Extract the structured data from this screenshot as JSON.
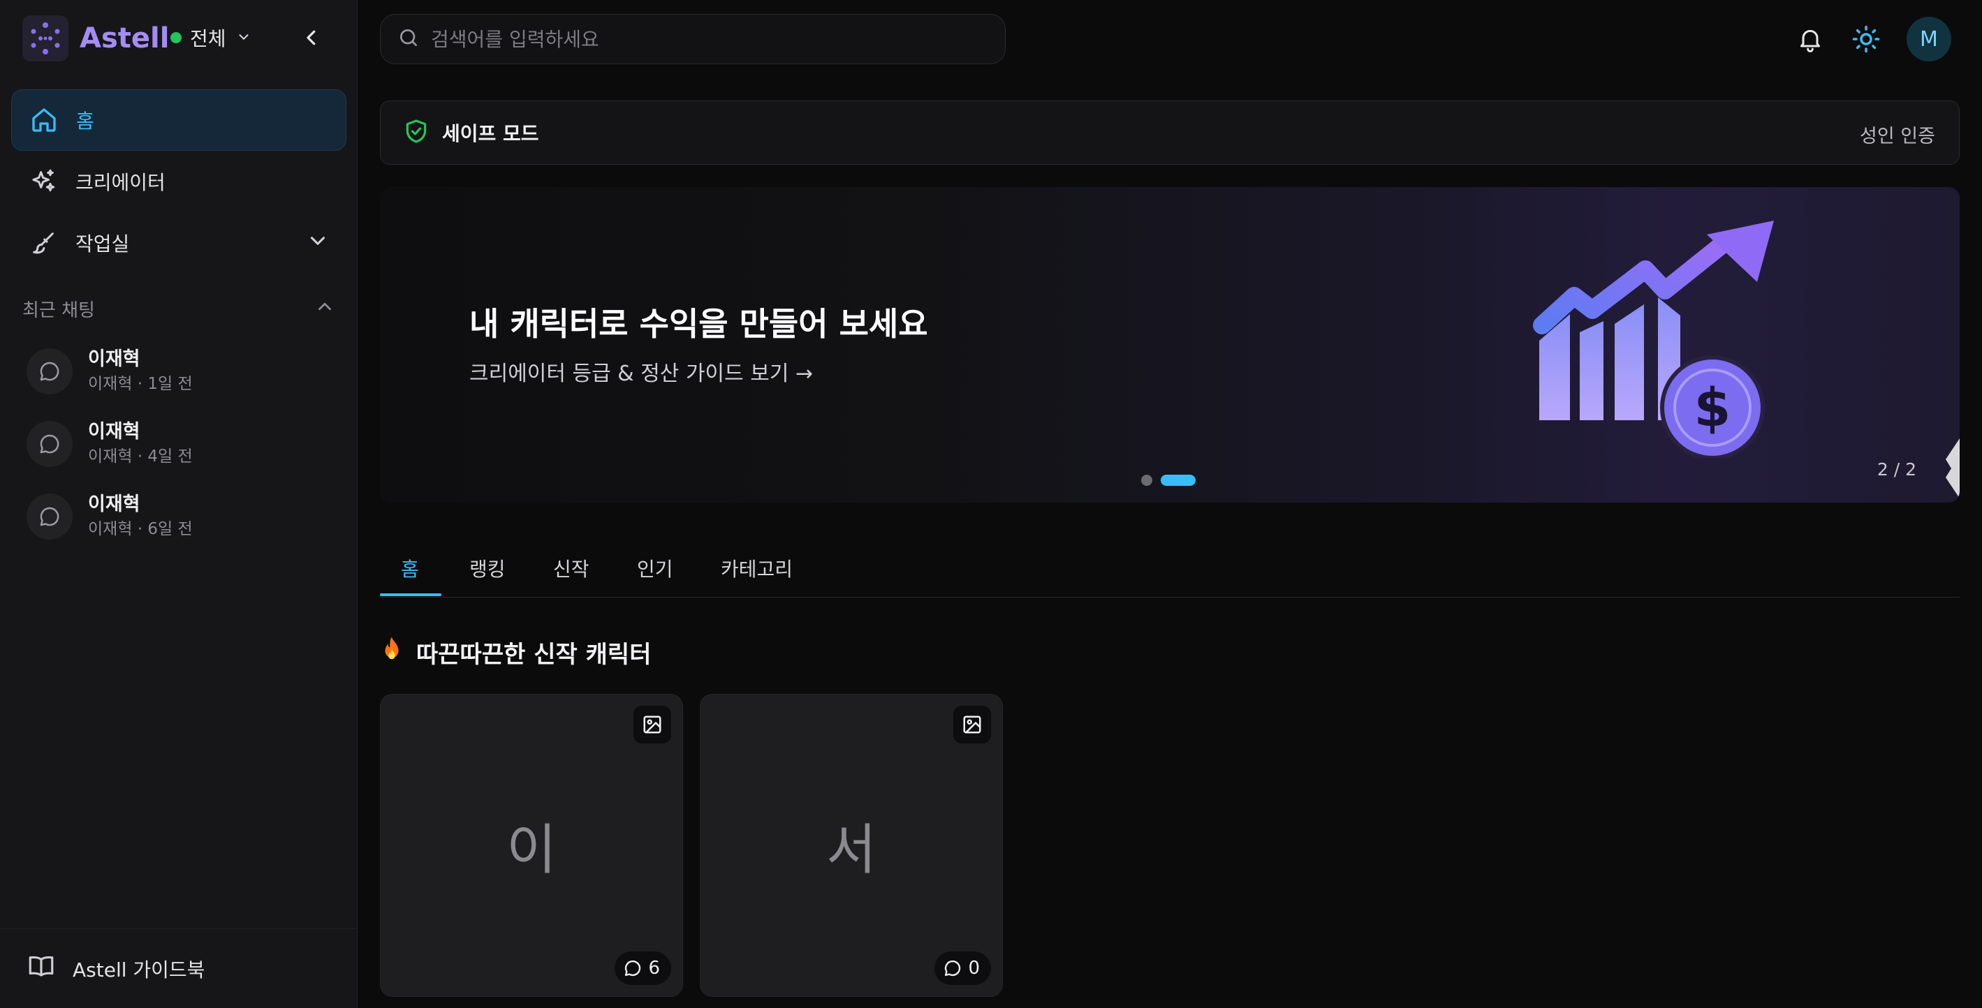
{
  "brand": {
    "name": "Astell",
    "scope_label": "전체",
    "accent": "#a58cf3"
  },
  "sidebar": {
    "nav": [
      {
        "label": "홈",
        "icon": "home-icon",
        "active": true
      },
      {
        "label": "크리에이터",
        "icon": "sparkles-icon",
        "active": false
      },
      {
        "label": "작업실",
        "icon": "brush-icon",
        "active": false
      }
    ],
    "recent_title": "최근 채팅",
    "recent_chats": [
      {
        "name": "이재혁",
        "meta": "이재혁 · 1일 전"
      },
      {
        "name": "이재혁",
        "meta": "이재혁 · 4일 전"
      },
      {
        "name": "이재혁",
        "meta": "이재혁 · 6일 전"
      }
    ],
    "footer_label": "Astell 가이드북"
  },
  "header": {
    "search_placeholder": "검색어를 입력하세요",
    "avatar_initial": "M"
  },
  "safe_mode": {
    "label": "세이프 모드",
    "action": "성인 인증"
  },
  "banner": {
    "title": "내 캐릭터로 수익을 만들어 보세요",
    "subtitle": "크리에이터 등급 & 정산 가이드 보기 →",
    "counter": "2 / 2",
    "slide_count": 2,
    "active_slide": 2
  },
  "tabs": [
    "홈",
    "랭킹",
    "신작",
    "인기",
    "카테고리"
  ],
  "section": {
    "title": "따끈따끈한 신작 캐릭터"
  },
  "cards": [
    {
      "initial": "이",
      "chat_count": "6"
    },
    {
      "initial": "서",
      "chat_count": "0"
    }
  ],
  "colors": {
    "accent_blue": "#38bdf8",
    "online_green": "#22c55e",
    "background": "#0b0b0c"
  }
}
